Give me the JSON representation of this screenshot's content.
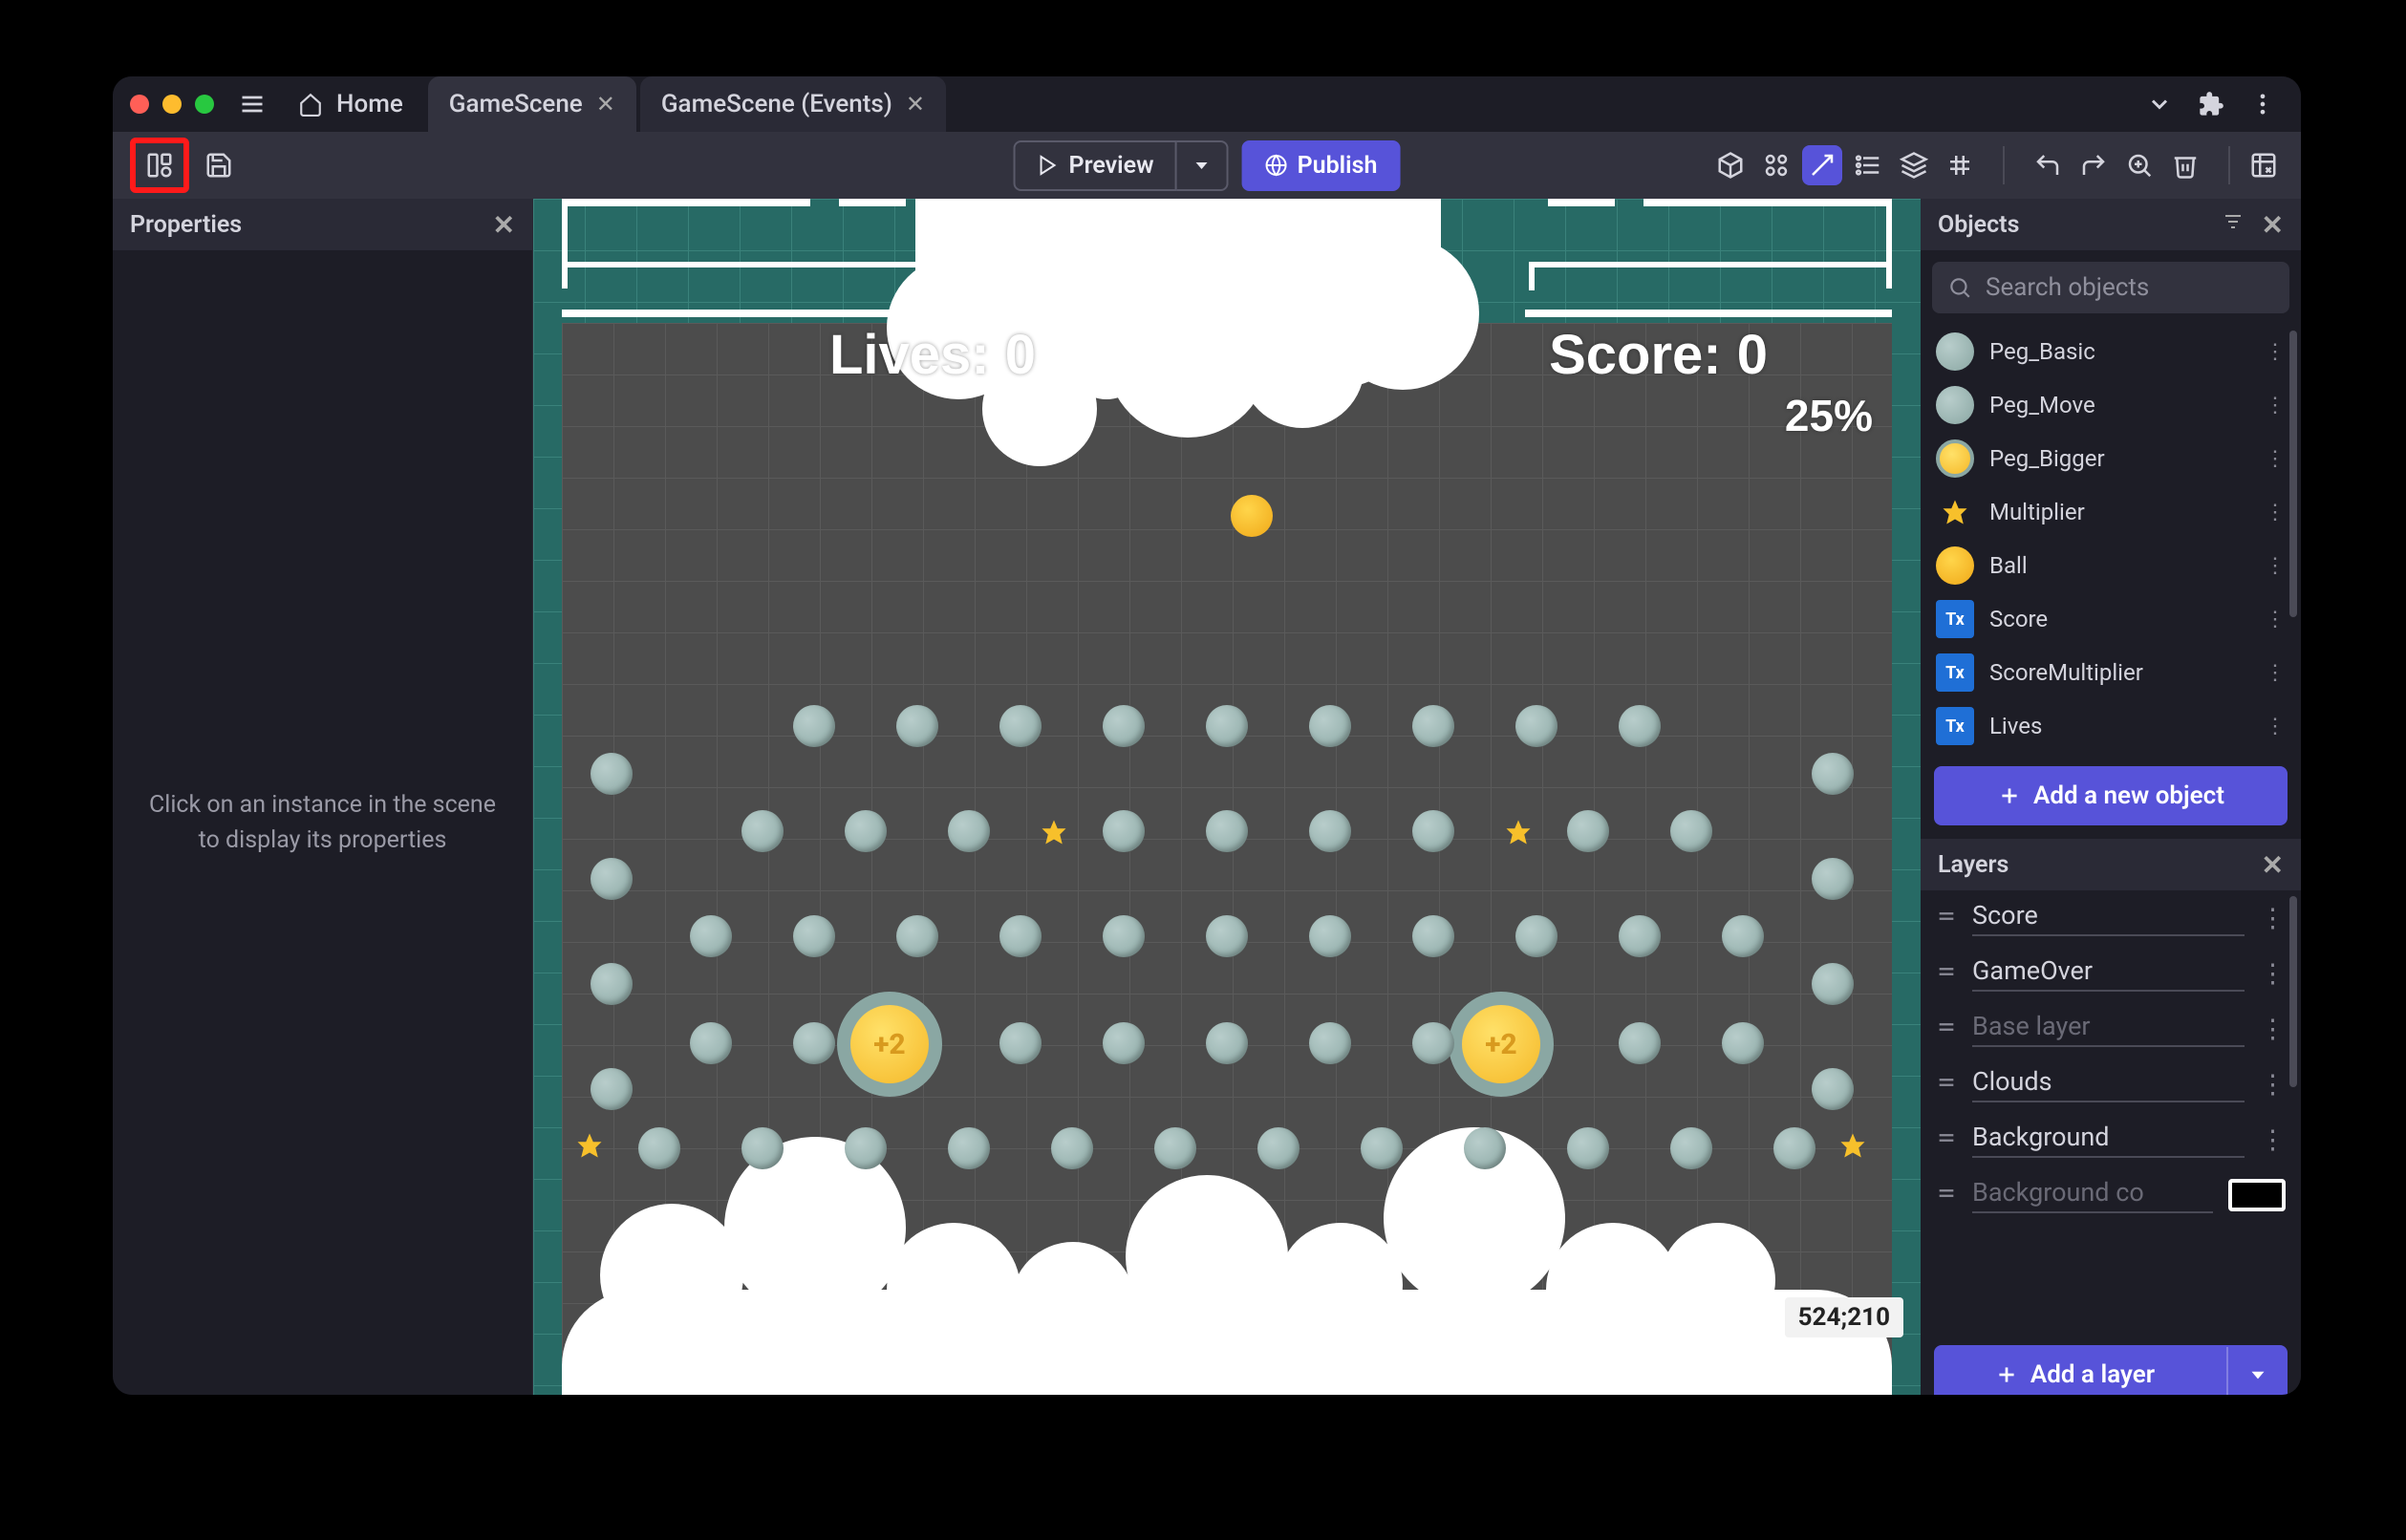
{
  "tabs": {
    "home": "Home",
    "scene": "GameScene",
    "events": "GameScene (Events)"
  },
  "toolbar": {
    "preview": "Preview",
    "publish": "Publish"
  },
  "properties": {
    "title": "Properties",
    "empty": "Click on an instance in the scene to display its properties"
  },
  "scene": {
    "lives_label": "Lives: 0",
    "score_label": "Score: 0",
    "multiplier_label": "25%",
    "coords": "524;210"
  },
  "objects": {
    "title": "Objects",
    "search_placeholder": "Search objects",
    "add_button": "Add a new object",
    "items": [
      {
        "name": "Peg_Basic",
        "thumb": "peg-t"
      },
      {
        "name": "Peg_Move",
        "thumb": "peg-t"
      },
      {
        "name": "Peg_Bigger",
        "thumb": "bigger-t"
      },
      {
        "name": "Multiplier",
        "thumb": "star-t"
      },
      {
        "name": "Ball",
        "thumb": "ball-t"
      },
      {
        "name": "Score",
        "thumb": "tx"
      },
      {
        "name": "ScoreMultiplier",
        "thumb": "tx"
      },
      {
        "name": "Lives",
        "thumb": "tx"
      }
    ]
  },
  "layers": {
    "title": "Layers",
    "add_button": "Add a layer",
    "items": [
      {
        "name": "Score"
      },
      {
        "name": "GameOver"
      },
      {
        "name": "Base layer",
        "dim": true
      },
      {
        "name": "Clouds"
      },
      {
        "name": "Background"
      },
      {
        "name": "Background co",
        "dim": true,
        "swatch": true
      }
    ]
  }
}
